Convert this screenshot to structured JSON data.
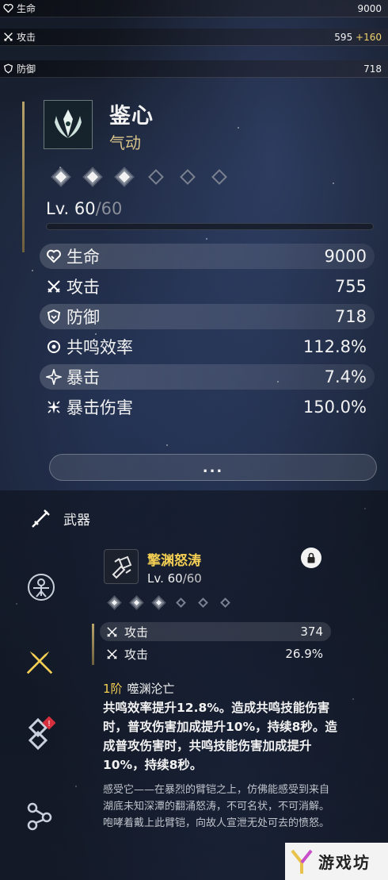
{
  "top_stats": [
    {
      "icon": "heart-icon",
      "label": "生命",
      "value": "9000",
      "bonus": ""
    },
    {
      "icon": "crossed-swords-icon",
      "label": "攻击",
      "value": "595",
      "bonus": "+160"
    },
    {
      "icon": "shield-icon",
      "label": "防御",
      "value": "718",
      "bonus": ""
    }
  ],
  "echo": {
    "name": "鉴心",
    "subtitle": "气动",
    "level": "Lv. 60",
    "level_sep": "/",
    "level_max": "60",
    "rank_filled": 3,
    "rank_total": 6,
    "stats": [
      {
        "icon": "heart-icon",
        "label": "生命",
        "value": "9000"
      },
      {
        "icon": "crossed-swords-icon",
        "label": "攻击",
        "value": "755"
      },
      {
        "icon": "shield-icon",
        "label": "防御",
        "value": "718"
      },
      {
        "icon": "resonance-icon",
        "label": "共鸣效率",
        "value": "112.8%"
      },
      {
        "icon": "crit-icon",
        "label": "暴击",
        "value": "7.4%"
      },
      {
        "icon": "crit-damage-icon",
        "label": "暴击伤害",
        "value": "150.0%"
      }
    ],
    "more_label": "..."
  },
  "weapon": {
    "section_label": "武器",
    "name": "擎渊怒涛",
    "level": "Lv. 60",
    "level_max": "/60",
    "rank_filled": 3,
    "rank_total": 6,
    "stats": [
      {
        "label": "攻击",
        "value": "374"
      },
      {
        "label": "攻击",
        "value": "26.9%"
      }
    ],
    "skill_rank": "1阶",
    "skill_name": "噬渊沦亡",
    "skill_desc": "共鸣效率提升12.8%。造成共鸣技能伤害时，普攻伤害加成提升10%，持续8秒。造成普攻伤害时，共鸣技能伤害加成提升10%，持续8秒。",
    "lore": "感受它——在暴烈的臂铠之上，仿佛能感受到来自湖底未知深潭的翻涌怒涛，不可名状，不可消解。咆哮着戴上此臂铠，向故人宣泄无处可去的愤怒。"
  },
  "colors": {
    "gold": "#f4cf53",
    "accent_sub": "#d7c38a",
    "alert": "#d6303f"
  },
  "watermark": "游戏坊"
}
